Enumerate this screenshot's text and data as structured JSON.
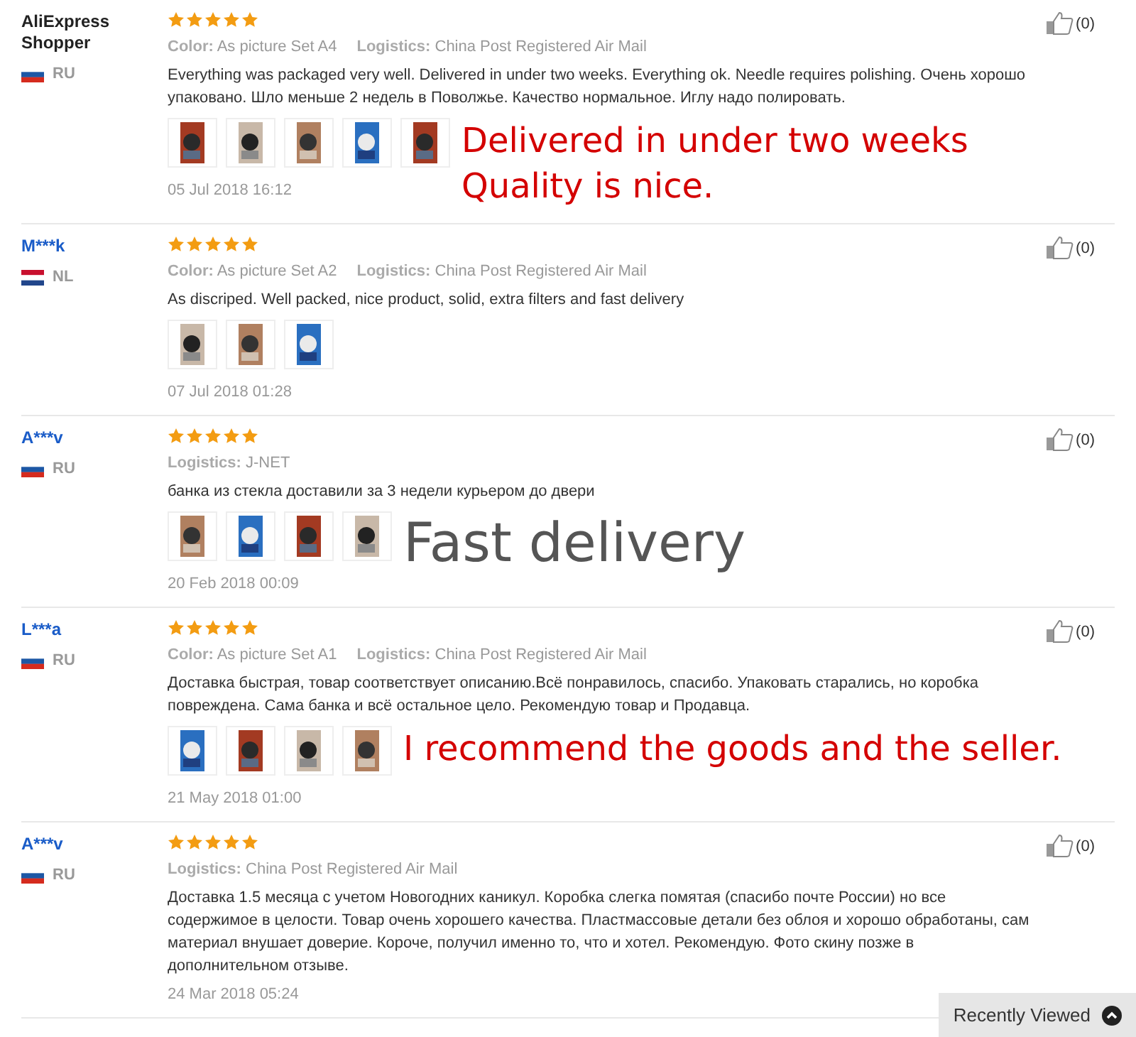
{
  "reviews": [
    {
      "user": "AliExpress Shopper",
      "kind": "guest",
      "country": "RU",
      "flag": {
        "kind": "ru"
      },
      "stars": 5,
      "attributes": [
        {
          "label": "Color:",
          "value": "As picture Set A4"
        },
        {
          "label": "Logistics:",
          "value": "China Post Registered Air Mail"
        }
      ],
      "text": "Everything was packaged very well. Delivered in under two weeks. Everything ok. Needle requires polishing. Очень хорошо упаковано. Шло меньше 2 недель в Поволжье. Качество нормальное. Иглу надо полировать.",
      "photos": [
        {
          "kind": "picture"
        },
        {
          "kind": "picture"
        },
        {
          "kind": "picture"
        },
        {
          "kind": "picture"
        },
        {
          "kind": "picture"
        }
      ],
      "caption": {
        "lines": [
          "Delivered in under two weeks",
          "Quality is nice."
        ],
        "color": "#d40000"
      },
      "date": "05 Jul 2018 16:12",
      "likes": "(0)"
    },
    {
      "user": "M***k",
      "kind": "member",
      "country": "NL",
      "flag": {
        "kind": "nl"
      },
      "stars": 5,
      "attributes": [
        {
          "label": "Color:",
          "value": "As picture Set A2"
        },
        {
          "label": "Logistics:",
          "value": "China Post Registered Air Mail"
        }
      ],
      "text": "As discriped. Well packed, nice product, solid, extra filters and fast delivery",
      "photos": [
        {
          "kind": "picture"
        },
        {
          "kind": "picture"
        },
        {
          "kind": "picture"
        }
      ],
      "date": "07 Jul 2018 01:28",
      "likes": "(0)"
    },
    {
      "user": "A***v",
      "kind": "member",
      "country": "RU",
      "flag": {
        "kind": "ru"
      },
      "stars": 5,
      "attributes": [
        {
          "label": "Logistics:",
          "value": "J-NET"
        }
      ],
      "text": "банка из стекла доставили за 3 недели курьером до двери",
      "photos": [
        {
          "kind": "picture"
        },
        {
          "kind": "picture"
        },
        {
          "kind": "picture"
        },
        {
          "kind": "picture"
        }
      ],
      "caption": {
        "lines": [
          "Fast delivery"
        ],
        "color": "#555555"
      },
      "date": "20 Feb 2018 00:09",
      "likes": "(0)"
    },
    {
      "user": "L***a",
      "kind": "member",
      "country": "RU",
      "flag": {
        "kind": "ru"
      },
      "stars": 5,
      "attributes": [
        {
          "label": "Color:",
          "value": "As picture Set A1"
        },
        {
          "label": "Logistics:",
          "value": "China Post Registered Air Mail"
        }
      ],
      "text": "Доставка быстрая, товар соответствует описанию.Всё понравилось, спасибо. Упаковать старались, но коробка повреждена. Сама банка и всё остальное цело. Рекомендую товар и Продавца.",
      "photos": [
        {
          "kind": "picture"
        },
        {
          "kind": "picture"
        },
        {
          "kind": "picture"
        },
        {
          "kind": "picture"
        }
      ],
      "caption": {
        "lines": [
          "I recommend the goods and the seller."
        ],
        "color": "#d40000"
      },
      "date": "21 May 2018 01:00",
      "likes": "(0)"
    },
    {
      "user": "A***v",
      "kind": "member",
      "country": "RU",
      "flag": {
        "kind": "ru"
      },
      "stars": 5,
      "attributes": [
        {
          "label": "Logistics:",
          "value": "China Post Registered Air Mail"
        }
      ],
      "text": "Доставка 1.5 месяца с учетом Новогодних каникул. Коробка слегка помятая (спасибо почте России) но все содержимое в целости. Товар очень хорошего качества. Пластмассовые детали без облоя и хорошо обработаны, сам материал внушает доверие. Короче, получил именно то, что и хотел. Рекомендую. Фото скину позже в дополнительном отзыве.",
      "date": "24 Mar 2018 05:24",
      "likes": "(0)"
    }
  ],
  "recently_viewed": {
    "label": "Recently Viewed"
  }
}
